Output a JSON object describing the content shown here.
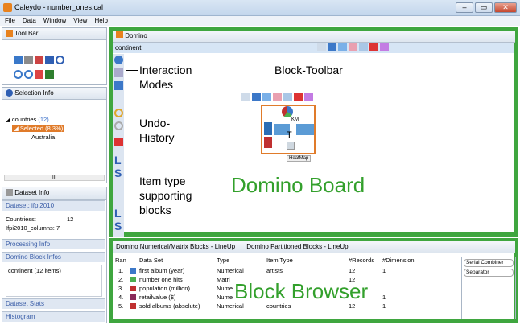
{
  "window": {
    "title": "Caleydo - number_ones.cal",
    "buttons": [
      "–",
      "▭",
      "✕"
    ]
  },
  "menu": [
    "File",
    "Data",
    "Window",
    "View",
    "Help"
  ],
  "toolbar_panel": {
    "tab": "Tool Bar"
  },
  "selection_panel": {
    "tab": "Selection Info",
    "tree": [
      {
        "label": "countries",
        "count": "(12)"
      },
      {
        "label": "Selected",
        "count": "(8.3%)"
      },
      {
        "label": "Australia",
        "count": ""
      }
    ],
    "scroll_label": "III"
  },
  "dataset_panel": {
    "tab": "Dataset Info",
    "dataset_label": "Dataset: ifpi2010",
    "countries_label": "Countriess:",
    "countries_value": "12",
    "columns_label": "Ifpi2010_columns: 7"
  },
  "sections": {
    "processing": "Processing Info",
    "block_infos": "Domino Block Infos",
    "block_infos_content": "continent (12 items)",
    "dataset_stats": "Dataset Stats",
    "histogram": "Histogram"
  },
  "domino": {
    "tab": "Domino",
    "crumb": "continent",
    "heatmap_tooltip": "HeatMap",
    "km_label": "KM",
    "t_label": "T",
    "side_letters": [
      "L",
      "S",
      "L",
      "S"
    ]
  },
  "annotations": {
    "interaction": "Interaction",
    "modes": "Modes",
    "undo": "Undo-",
    "history": "History",
    "item": "Item type",
    "supporting": "supporting",
    "blocks": "blocks",
    "block_toolbar": "Block-Toolbar",
    "board": "Domino Board",
    "browser": "Block Browser"
  },
  "browser": {
    "tabs": [
      "Domino Numerical/Matrix Blocks - LineUp",
      "Domino Partitioned Blocks - LineUp"
    ],
    "columns": [
      "Ran",
      "Data Set",
      "Type",
      "Item Type",
      "#Records",
      "#Dimension"
    ],
    "rows": [
      {
        "rank": "1.",
        "name": "first album (year)",
        "type": "Numerical",
        "item": "artists",
        "records": "12",
        "dims": "1",
        "color": "#3c78c8"
      },
      {
        "rank": "2.",
        "name": "number one hits",
        "type": "Matri",
        "item": "",
        "records": "12",
        "dims": "",
        "color": "#4caf50"
      },
      {
        "rank": "3.",
        "name": "population (million)",
        "type": "Nume",
        "item": "",
        "records": "",
        "dims": "",
        "color": "#c03030"
      },
      {
        "rank": "4.",
        "name": "retailvalue ($)",
        "type": "Nume",
        "item": "",
        "records": "",
        "dims": "1",
        "color": "#8a2b5a"
      },
      {
        "rank": "5.",
        "name": "sold albums (absolute)",
        "type": "Numerical",
        "item": "countries",
        "records": "12",
        "dims": "1",
        "color": "#c03030"
      }
    ],
    "combiners": [
      "Serial Combiner",
      "Separator"
    ]
  },
  "colors": {
    "accent_green": "#3fa63f",
    "board_orange": "#e07b2a",
    "selected": "#e07b2a"
  }
}
